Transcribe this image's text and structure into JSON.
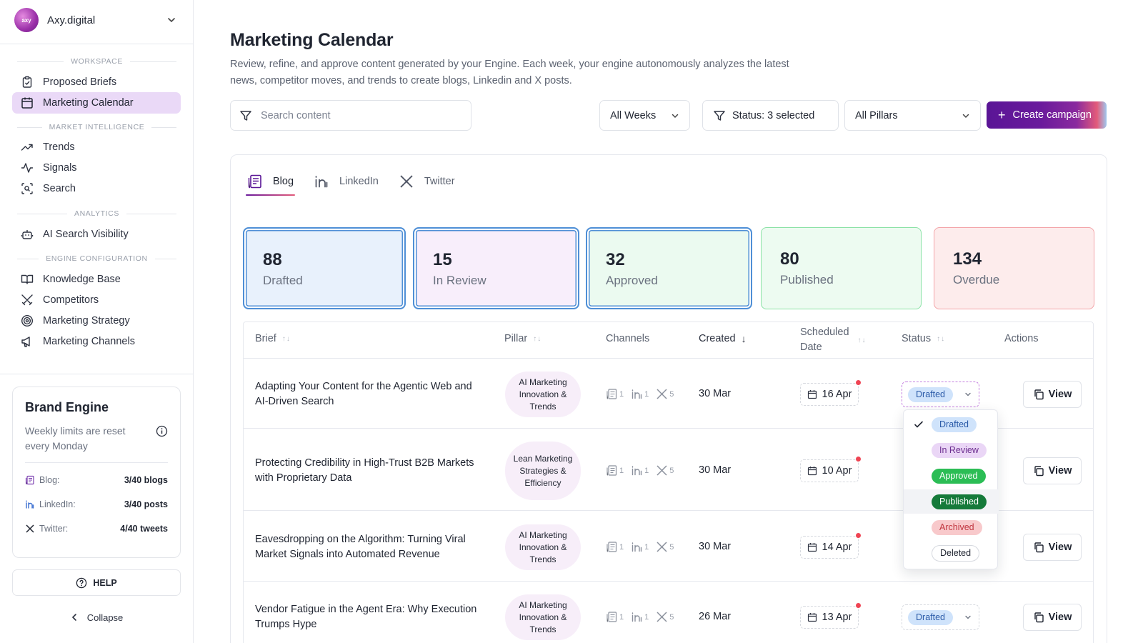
{
  "org": {
    "name": "Axy.digital",
    "logo_text": "axy"
  },
  "sidebar": {
    "sections": [
      {
        "label": "WORKSPACE"
      },
      {
        "label": "MARKET INTELLIGENCE"
      },
      {
        "label": "ANALYTICS"
      },
      {
        "label": "ENGINE CONFIGURATION"
      }
    ],
    "items": [
      {
        "label": "Proposed Briefs",
        "icon": "clipboard-icon"
      },
      {
        "label": "Marketing Calendar",
        "icon": "calendar-icon",
        "active": true
      },
      {
        "label": "Trends",
        "icon": "trend-up-icon"
      },
      {
        "label": "Signals",
        "icon": "activity-icon"
      },
      {
        "label": "Search",
        "icon": "scan-search-icon"
      },
      {
        "label": "AI Search Visibility",
        "icon": "bot-icon"
      },
      {
        "label": "Knowledge Base",
        "icon": "book-icon"
      },
      {
        "label": "Competitors",
        "icon": "swords-icon"
      },
      {
        "label": "Marketing Strategy",
        "icon": "target-icon"
      },
      {
        "label": "Marketing Channels",
        "icon": "megaphone-icon"
      }
    ]
  },
  "brand_engine": {
    "title": "Brand Engine",
    "note": "Weekly limits are reset every Monday",
    "limits": [
      {
        "label": "Blog:",
        "value": "3/40 blogs"
      },
      {
        "label": "LinkedIn:",
        "value": "3/40 posts"
      },
      {
        "label": "Twitter:",
        "value": "4/40 tweets"
      }
    ]
  },
  "help_label": "HELP",
  "collapse_label": "Collapse",
  "page": {
    "title": "Marketing Calendar",
    "description": "Review, refine, and approve content generated by your Engine. Each week, your engine autonomously analyzes the latest news, competitor moves, and trends to create blogs, Linkedin and X posts."
  },
  "toolbar": {
    "search_placeholder": "Search content",
    "weeks": "All Weeks",
    "status": "Status: 3 selected",
    "pillars": "All Pillars",
    "create": "Create campaign"
  },
  "tabs": [
    {
      "label": "Blog",
      "active": true
    },
    {
      "label": "LinkedIn"
    },
    {
      "label": "Twitter"
    }
  ],
  "stats": [
    {
      "value": "88",
      "label": "Drafted",
      "bg": "#e8f1fc",
      "border": "#4f8fd6"
    },
    {
      "value": "15",
      "label": "In Review",
      "bg": "#f8eefb",
      "border": "#4f8fd6"
    },
    {
      "value": "32",
      "label": "Approved",
      "bg": "#ebfaf0",
      "border": "#4f8fd6"
    },
    {
      "value": "80",
      "label": "Published",
      "bg": "#edfbf1",
      "border": "#8be2a6"
    },
    {
      "value": "134",
      "label": "Overdue",
      "bg": "#fdecec",
      "border": "#f3a4a8"
    }
  ],
  "table": {
    "headers": {
      "brief": "Brief",
      "pillar": "Pillar",
      "channels": "Channels",
      "created": "Created",
      "scheduled_line1": "Scheduled",
      "scheduled_line2": "Date",
      "status": "Status",
      "actions": "Actions"
    },
    "sort_icon": "↑↓",
    "created_sort_icon": "↓",
    "view_label": "View",
    "rows": [
      {
        "brief": "Adapting Your Content for the Agentic Web and AI-Driven Search",
        "pillar": "AI Marketing Innovation & Trends",
        "blog": "1",
        "linkedin": "1",
        "twitter": "5",
        "created": "30 Mar",
        "scheduled": "16 Apr",
        "status": "Drafted"
      },
      {
        "brief": "Protecting Credibility in High-Trust B2B Markets with Proprietary Data",
        "pillar": "Lean Marketing Strategies & Efficiency",
        "blog": "1",
        "linkedin": "1",
        "twitter": "5",
        "created": "30 Mar",
        "scheduled": "10 Apr",
        "status": ""
      },
      {
        "brief": "Eavesdropping on the Algorithm: Turning Viral Market Signals into Automated Revenue",
        "pillar": "AI Marketing Innovation & Trends",
        "blog": "1",
        "linkedin": "1",
        "twitter": "5",
        "created": "30 Mar",
        "scheduled": "14 Apr",
        "status": ""
      },
      {
        "brief": "Vendor Fatigue in the Agent Era: Why Execution Trumps Hype",
        "pillar": "AI Marketing Innovation & Trends",
        "blog": "1",
        "linkedin": "1",
        "twitter": "5",
        "created": "26 Mar",
        "scheduled": "13 Apr",
        "status": "Drafted"
      }
    ]
  },
  "status_dropdown": {
    "options": [
      "Drafted",
      "In Review",
      "Approved",
      "Published",
      "Archived",
      "Deleted"
    ],
    "selected": "Drafted",
    "highlighted": "Published"
  }
}
